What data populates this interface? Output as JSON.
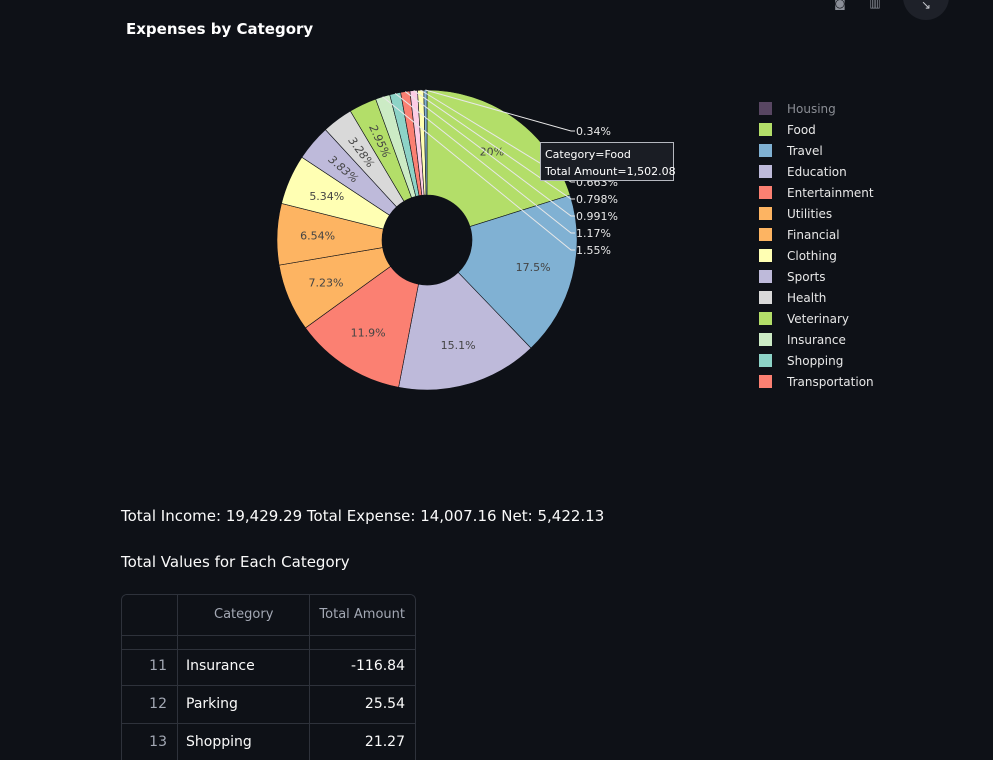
{
  "chart_data": {
    "type": "pie",
    "title": "Expenses by Category",
    "hole": true,
    "labels": [
      "Food",
      "Travel",
      "Education",
      "Entertainment",
      "Utilities",
      "Financial",
      "Clothing",
      "Sports",
      "Health",
      "Veterinary",
      "Insurance",
      "Shopping",
      "Transportation"
    ],
    "values": [
      20,
      17.5,
      15.1,
      11.9,
      7.23,
      6.54,
      5.34,
      3.83,
      3.28,
      2.95,
      1.55,
      1.17,
      0.991,
      0.798,
      0.663,
      0.34
    ],
    "slices": [
      {
        "label": "Food",
        "percent": 20,
        "percent_text": "20%",
        "color": "#b3de69"
      },
      {
        "label": "Travel",
        "percent": 17.5,
        "percent_text": "17.5%",
        "color": "#80b1d3"
      },
      {
        "label": "Education",
        "percent": 15.1,
        "percent_text": "15.1%",
        "color": "#bebada"
      },
      {
        "label": "Entertainment",
        "percent": 11.9,
        "percent_text": "11.9%",
        "color": "#fb8072"
      },
      {
        "label": "Utilities",
        "percent": 7.23,
        "percent_text": "7.23%",
        "color": "#fdb462"
      },
      {
        "label": "Financial",
        "percent": 6.54,
        "percent_text": "6.54%",
        "color": "#fdb462"
      },
      {
        "label": "Clothing",
        "percent": 5.34,
        "percent_text": "5.34%",
        "color": "#ffffb3"
      },
      {
        "label": "Sports",
        "percent": 3.83,
        "percent_text": "3.83%",
        "color": "#bebada"
      },
      {
        "label": "Health",
        "percent": 3.28,
        "percent_text": "3.28%",
        "color": "#d9d9d9"
      },
      {
        "label": "Veterinary",
        "percent": 2.95,
        "percent_text": "2.95%",
        "color": "#b3de69"
      },
      {
        "label": "Insurance",
        "percent": 1.55,
        "percent_text": "1.55%",
        "color": "#ccebc5"
      },
      {
        "label": "Shopping",
        "percent": 1.17,
        "percent_text": "1.17%",
        "color": "#8dd3c7"
      },
      {
        "label": "Transportation",
        "percent": 0.991,
        "percent_text": "0.991%",
        "color": "#fb8072"
      },
      {
        "label": "",
        "percent": 0.798,
        "percent_text": "0.798%",
        "color": "#fccde5"
      },
      {
        "label": "",
        "percent": 0.663,
        "percent_text": "0.663%",
        "color": "#ffffb3"
      },
      {
        "label": "",
        "percent": 0.34,
        "percent_text": "0.34%",
        "color": "#80b1d3"
      }
    ],
    "legend": [
      {
        "label": "Housing",
        "color": "#6b5475",
        "dimmed": true
      },
      {
        "label": "Food",
        "color": "#b3de69"
      },
      {
        "label": "Travel",
        "color": "#80b1d3"
      },
      {
        "label": "Education",
        "color": "#bebada"
      },
      {
        "label": "Entertainment",
        "color": "#fb8072"
      },
      {
        "label": "Utilities",
        "color": "#fdb462"
      },
      {
        "label": "Financial",
        "color": "#fdb462"
      },
      {
        "label": "Clothing",
        "color": "#ffffb3"
      },
      {
        "label": "Sports",
        "color": "#bebada"
      },
      {
        "label": "Health",
        "color": "#d9d9d9"
      },
      {
        "label": "Veterinary",
        "color": "#b3de69"
      },
      {
        "label": "Insurance",
        "color": "#ccebc5"
      },
      {
        "label": "Shopping",
        "color": "#8dd3c7"
      },
      {
        "label": "Transportation",
        "color": "#fb8072"
      }
    ],
    "legend_placement": "right",
    "tooltip": {
      "line1": "Category=Food",
      "line2": "Total Amount=1,502.08"
    }
  },
  "summary_text": "Total Income: 19,429.29 Total Expense: 14,007.16 Net: 5,422.13",
  "table": {
    "title": "Total Values for Each Category",
    "columns": [
      "",
      "Category",
      "Total Amount"
    ],
    "rows": [
      {
        "index": "11",
        "category": "Insurance",
        "amount": "-116.84"
      },
      {
        "index": "12",
        "category": "Parking",
        "amount": "25.54"
      },
      {
        "index": "13",
        "category": "Shopping",
        "amount": "21.27"
      }
    ]
  },
  "toolbar": {
    "icons": [
      "camera-icon",
      "bar-chart-icon"
    ],
    "expand_icon": "expand-icon"
  }
}
